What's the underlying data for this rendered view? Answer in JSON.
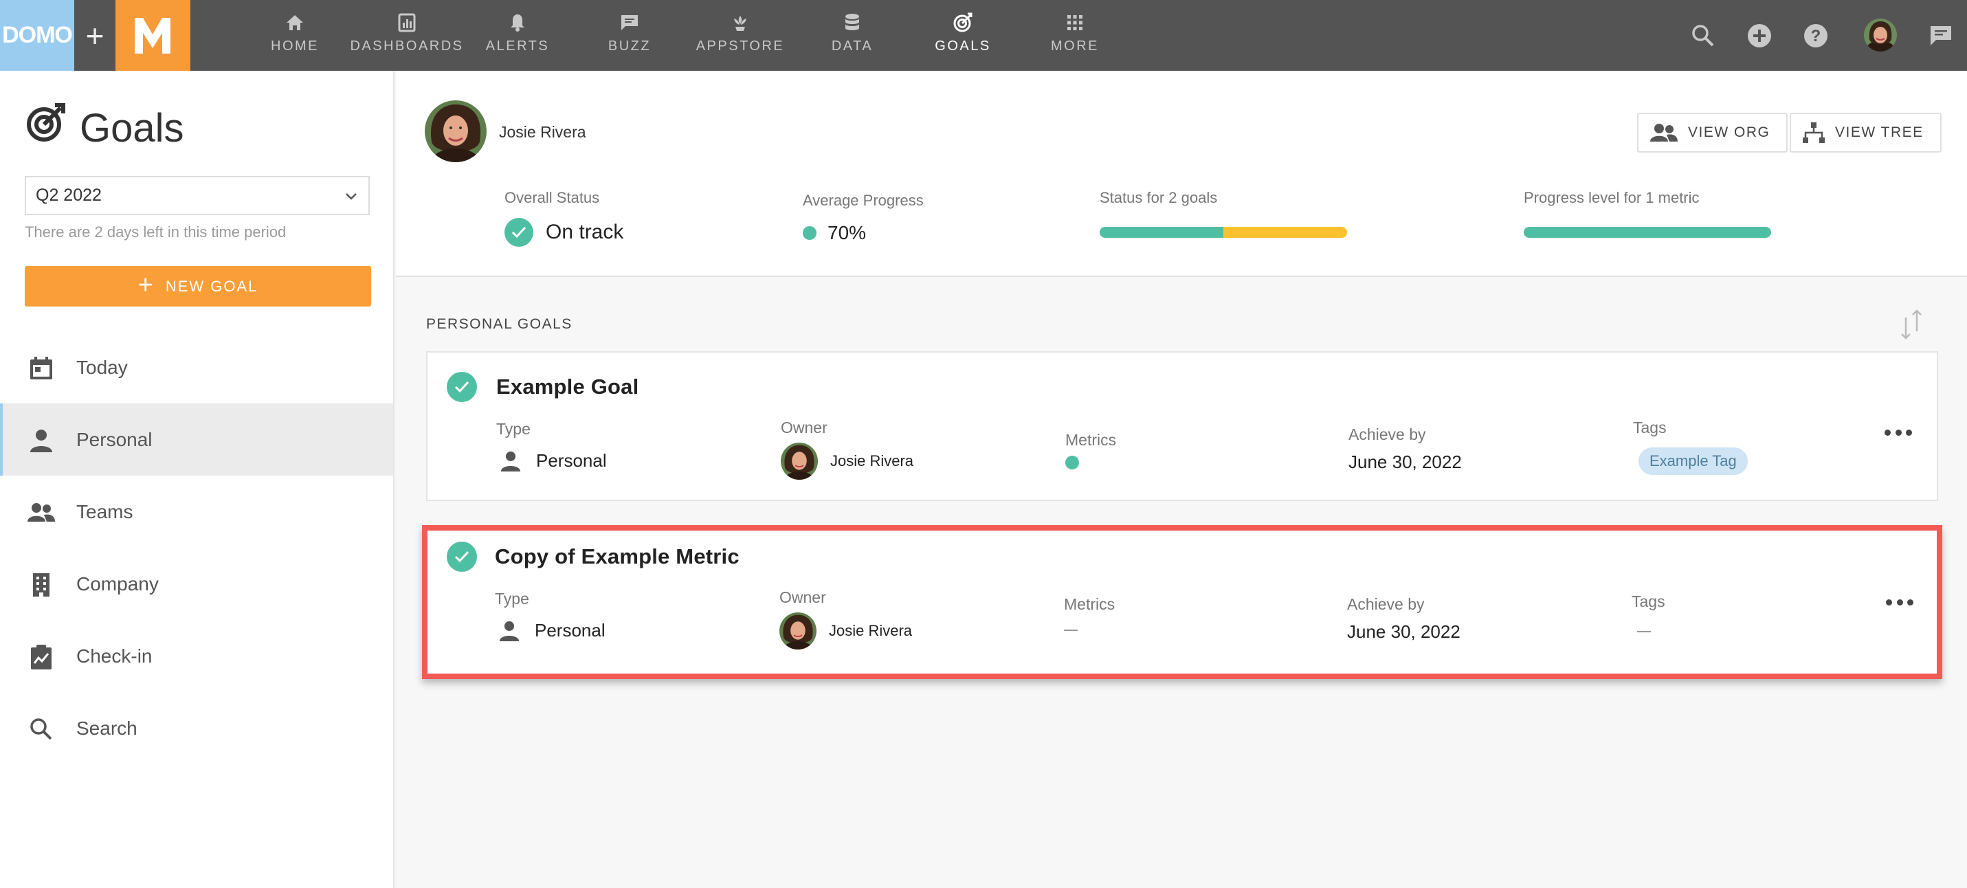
{
  "brand": {
    "domo": "DOMO",
    "plus": "+",
    "m": "M"
  },
  "nav": [
    {
      "label": "HOME",
      "icon": "home-icon"
    },
    {
      "label": "DASHBOARDS",
      "icon": "dashboards-icon"
    },
    {
      "label": "ALERTS",
      "icon": "bell-icon"
    },
    {
      "label": "BUZZ",
      "icon": "chat-icon"
    },
    {
      "label": "APPSTORE",
      "icon": "appstore-icon"
    },
    {
      "label": "DATA",
      "icon": "database-icon"
    },
    {
      "label": "GOALS",
      "icon": "goals-icon",
      "active": true
    },
    {
      "label": "MORE",
      "icon": "grid-icon"
    }
  ],
  "topright": {
    "icons": [
      "search-icon",
      "add-icon",
      "help-icon",
      "avatar",
      "chat-icon"
    ]
  },
  "sidebar": {
    "title": "Goals",
    "period": "Q2 2022",
    "period_note": "There are 2 days left in this time period",
    "new_goal": "NEW GOAL",
    "items": [
      {
        "label": "Today",
        "icon": "calendar-icon"
      },
      {
        "label": "Personal",
        "icon": "person-icon",
        "active": true
      },
      {
        "label": "Teams",
        "icon": "people-icon"
      },
      {
        "label": "Company",
        "icon": "building-icon"
      },
      {
        "label": "Check-in",
        "icon": "checkin-icon"
      },
      {
        "label": "Search",
        "icon": "search-icon"
      }
    ]
  },
  "header": {
    "user_name": "Josie Rivera",
    "view_org": "VIEW ORG",
    "view_tree": "VIEW TREE",
    "overall_status_label": "Overall Status",
    "overall_status_value": "On track",
    "avg_progress_label": "Average Progress",
    "avg_progress_value": "70%",
    "status_goals_label": "Status for 2 goals",
    "status_goals_split": {
      "on_track_fraction": 0.5,
      "at_risk_fraction": 0.5
    },
    "progress_metric_label": "Progress level for 1 metric",
    "progress_metric_fraction": 1.0
  },
  "colors": {
    "accent_orange": "#f99e38",
    "on_track_green": "#4fbfa3",
    "at_risk_yellow": "#fbc12e",
    "highlight_red": "#f45a55",
    "brand_blue": "#99ccee"
  },
  "section": {
    "title": "PERSONAL GOALS"
  },
  "goals": [
    {
      "title": "Example Goal",
      "type_label": "Type",
      "type_value": "Personal",
      "owner_label": "Owner",
      "owner_value": "Josie Rivera",
      "metrics_label": "Metrics",
      "achieve_label": "Achieve by",
      "achieve_value": "June 30, 2022",
      "tags_label": "Tags",
      "tag": "Example Tag"
    },
    {
      "title": "Copy of Example Metric",
      "type_label": "Type",
      "type_value": "Personal",
      "owner_label": "Owner",
      "owner_value": "Josie Rivera",
      "metrics_label": "Metrics",
      "achieve_label": "Achieve by",
      "achieve_value": "June 30, 2022",
      "tags_label": "Tags"
    }
  ]
}
